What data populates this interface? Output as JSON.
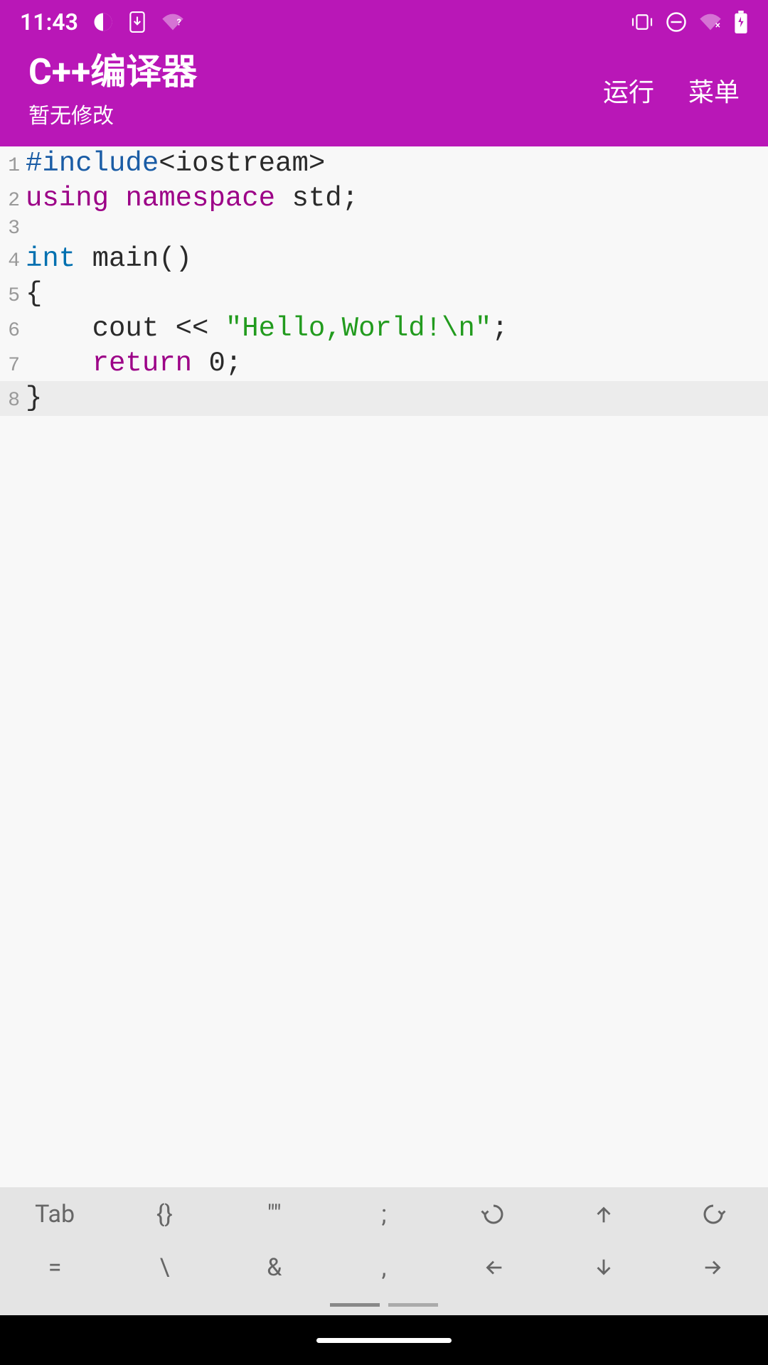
{
  "statusBar": {
    "time": "11:43"
  },
  "header": {
    "title": "C++编译器",
    "subtitle": "暂无修改",
    "runLabel": "运行",
    "menuLabel": "菜单"
  },
  "code": {
    "lines": [
      {
        "n": "1",
        "tokens": [
          {
            "t": "#include",
            "c": "tok-preprocessor"
          },
          {
            "t": "<iostream>",
            "c": "tok-default"
          }
        ]
      },
      {
        "n": "2",
        "tokens": [
          {
            "t": "using ",
            "c": "tok-keyword"
          },
          {
            "t": "namespace ",
            "c": "tok-keyword"
          },
          {
            "t": "std;",
            "c": "tok-default"
          }
        ]
      },
      {
        "n": "3",
        "tokens": [
          {
            "t": "",
            "c": "tok-default"
          }
        ]
      },
      {
        "n": "4",
        "tokens": [
          {
            "t": "int ",
            "c": "tok-type"
          },
          {
            "t": "main()",
            "c": "tok-default"
          }
        ]
      },
      {
        "n": "5",
        "tokens": [
          {
            "t": "{",
            "c": "tok-default"
          }
        ]
      },
      {
        "n": "6",
        "tokens": [
          {
            "t": "    cout << ",
            "c": "tok-default"
          },
          {
            "t": "\"Hello,World!\\n\"",
            "c": "tok-string"
          },
          {
            "t": ";",
            "c": "tok-default"
          }
        ]
      },
      {
        "n": "7",
        "tokens": [
          {
            "t": "    ",
            "c": "tok-default"
          },
          {
            "t": "return ",
            "c": "tok-keyword"
          },
          {
            "t": "0;",
            "c": "tok-default"
          }
        ]
      },
      {
        "n": "8",
        "tokens": [
          {
            "t": "}",
            "c": "tok-default"
          }
        ],
        "highlighted": true
      }
    ]
  },
  "toolbar": {
    "row1": [
      "Tab",
      "{}",
      "\"\"",
      ";",
      "undo",
      "up",
      "redo"
    ],
    "row2": [
      "=",
      "\\",
      "&",
      ",",
      "left",
      "down",
      "right"
    ]
  }
}
